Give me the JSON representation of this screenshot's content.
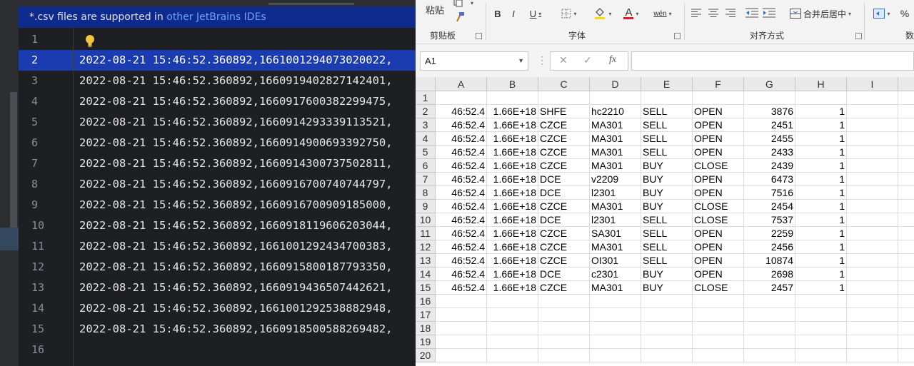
{
  "ide": {
    "banner_prefix": "*.csv files are supported in ",
    "banner_link": "other JetBrains IDEs",
    "active_line": 2,
    "line_numbers": [
      "1",
      "2",
      "3",
      "4",
      "5",
      "6",
      "7",
      "8",
      "9",
      "10",
      "11",
      "12",
      "13",
      "14",
      "15",
      "16"
    ],
    "lines": [
      "",
      "2022-08-21 15:46:52.360892,1661001294073020022,",
      "2022-08-21 15:46:52.360892,1660919402827142401,",
      "2022-08-21 15:46:52.360892,1660917600382299475,",
      "2022-08-21 15:46:52.360892,1660914293339113521,",
      "2022-08-21 15:46:52.360892,1660914900693392750,",
      "2022-08-21 15:46:52.360892,1660914300737502811,",
      "2022-08-21 15:46:52.360892,1660916700740744797,",
      "2022-08-21 15:46:52.360892,1660916700909185000,",
      "2022-08-21 15:46:52.360892,1660918119606203044,",
      "2022-08-21 15:46:52.360892,1661001292434700383,",
      "2022-08-21 15:46:52.360892,1660915800187793350,",
      "2022-08-21 15:46:52.360892,1660919436507442621,",
      "2022-08-21 15:46:52.360892,1661001292538882948,",
      "2022-08-21 15:46:52.360892,1660918500588269482,",
      ""
    ],
    "icons": {
      "intention": "lightbulb-icon"
    }
  },
  "excel": {
    "ribbon": {
      "paste_label": "粘贴",
      "clipboard_group": "剪贴板",
      "font_group": "字体",
      "align_group": "对齐方式",
      "number_group_partial": "数",
      "bold": "B",
      "italic": "I",
      "underline": "U",
      "font_color_glyph": "A",
      "wrap_glyph": "wén",
      "merge_label": "合并后居中",
      "percent": "%"
    },
    "name_box": "A1",
    "formula_value": "",
    "fx_label": "fx",
    "columns": [
      "A",
      "B",
      "C",
      "D",
      "E",
      "F",
      "G",
      "H",
      "I"
    ],
    "row_headers": [
      "1",
      "2",
      "3",
      "4",
      "5",
      "6",
      "7",
      "8",
      "9",
      "10",
      "11",
      "12",
      "13",
      "14",
      "15",
      "16",
      "17",
      "18",
      "19",
      "20"
    ],
    "rows": [
      [
        "",
        "",
        "",
        "",
        "",
        "",
        "",
        "",
        ""
      ],
      [
        "46:52.4",
        "1.66E+18",
        "SHFE",
        "hc2210",
        "SELL",
        "OPEN",
        "3876",
        "1",
        ""
      ],
      [
        "46:52.4",
        "1.66E+18",
        "CZCE",
        "MA301",
        "SELL",
        "OPEN",
        "2451",
        "1",
        ""
      ],
      [
        "46:52.4",
        "1.66E+18",
        "CZCE",
        "MA301",
        "SELL",
        "OPEN",
        "2455",
        "1",
        ""
      ],
      [
        "46:52.4",
        "1.66E+18",
        "CZCE",
        "MA301",
        "SELL",
        "OPEN",
        "2433",
        "1",
        ""
      ],
      [
        "46:52.4",
        "1.66E+18",
        "CZCE",
        "MA301",
        "BUY",
        "CLOSE",
        "2439",
        "1",
        ""
      ],
      [
        "46:52.4",
        "1.66E+18",
        "DCE",
        "v2209",
        "BUY",
        "OPEN",
        "6473",
        "1",
        ""
      ],
      [
        "46:52.4",
        "1.66E+18",
        "DCE",
        "l2301",
        "BUY",
        "OPEN",
        "7516",
        "1",
        ""
      ],
      [
        "46:52.4",
        "1.66E+18",
        "CZCE",
        "MA301",
        "BUY",
        "CLOSE",
        "2454",
        "1",
        ""
      ],
      [
        "46:52.4",
        "1.66E+18",
        "DCE",
        "l2301",
        "SELL",
        "CLOSE",
        "7537",
        "1",
        ""
      ],
      [
        "46:52.4",
        "1.66E+18",
        "CZCE",
        "SA301",
        "SELL",
        "OPEN",
        "2259",
        "1",
        ""
      ],
      [
        "46:52.4",
        "1.66E+18",
        "CZCE",
        "MA301",
        "SELL",
        "OPEN",
        "2456",
        "1",
        ""
      ],
      [
        "46:52.4",
        "1.66E+18",
        "CZCE",
        "OI301",
        "SELL",
        "OPEN",
        "10874",
        "1",
        ""
      ],
      [
        "46:52.4",
        "1.66E+18",
        "DCE",
        "c2301",
        "BUY",
        "OPEN",
        "2698",
        "1",
        ""
      ],
      [
        "46:52.4",
        "1.66E+18",
        "CZCE",
        "MA301",
        "BUY",
        "CLOSE",
        "2457",
        "1",
        ""
      ],
      [
        "",
        "",
        "",
        "",
        "",
        "",
        "",
        "",
        ""
      ],
      [
        "",
        "",
        "",
        "",
        "",
        "",
        "",
        "",
        ""
      ],
      [
        "",
        "",
        "",
        "",
        "",
        "",
        "",
        "",
        ""
      ],
      [
        "",
        "",
        "",
        "",
        "",
        "",
        "",
        "",
        ""
      ],
      [
        "",
        "",
        "",
        "",
        "",
        "",
        "",
        "",
        ""
      ]
    ],
    "numeric_columns": [
      0,
      1,
      6,
      7
    ],
    "colors": {
      "font_color_bar": "#e02020",
      "fill_color_bar": "#ffd800"
    }
  }
}
